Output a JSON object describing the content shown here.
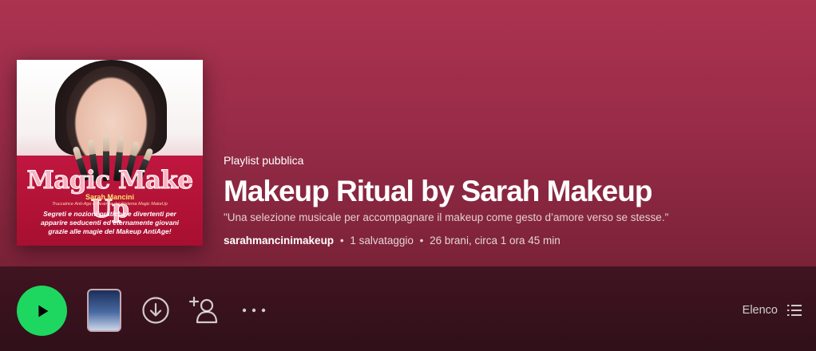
{
  "playlist": {
    "type_label": "Playlist pubblica",
    "title": "Makeup Ritual by Sarah Makeup",
    "description": "\"Una selezione musicale per accompagnare il makeup come gesto d’amore verso se stesse.\"",
    "owner": "sarahmancinimakeup",
    "saves": "1 salvataggio",
    "tracks_duration": "26 brani, circa 1 ora 45 min",
    "separator": "•"
  },
  "cover": {
    "title": "Magic Make Up",
    "author": "Sarah Mancini",
    "subtitle": "Truccatrice Anti-Age e ideatrice del Sistema Magic MakeUp",
    "blurb_line1": "Segreti e nozioni pratiche e divertenti per",
    "blurb_line2": "apparire seducenti ed eternamente giovani",
    "blurb_line3": "grazie alle magie del Makeup AntiAge!"
  },
  "actions": {
    "view_label": "Elenco",
    "icons": {
      "play": "play-icon",
      "download": "download-icon",
      "follow": "add-user-icon",
      "more": "more-icon",
      "list": "list-icon"
    }
  },
  "colors": {
    "header_top": "#ab3350",
    "header_bottom": "#7a2238",
    "action_bar": "#401420",
    "play_green": "#1ed760"
  }
}
